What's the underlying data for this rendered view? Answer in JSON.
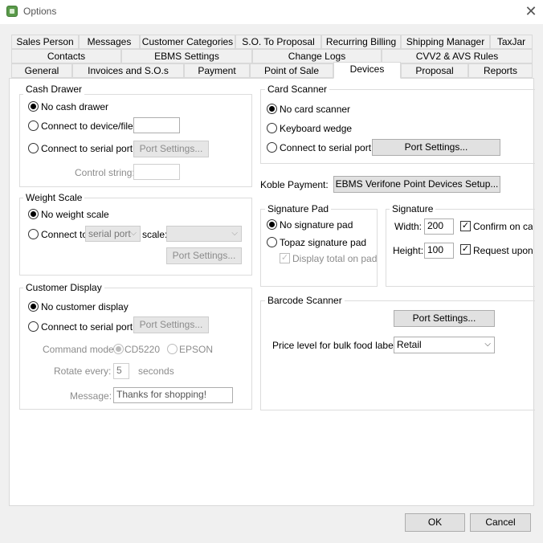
{
  "window": {
    "title": "Options"
  },
  "tabs": {
    "row1": [
      "Sales Person",
      "Messages",
      "Customer Categories",
      "S.O. To Proposal",
      "Recurring Billing",
      "Shipping Manager",
      "TaxJar"
    ],
    "row2": [
      "Contacts",
      "EBMS Settings",
      "Change Logs",
      "CVV2 & AVS Rules"
    ],
    "row3": [
      "General",
      "Invoices and S.O.s",
      "Payment",
      "Point of Sale",
      "Devices",
      "Proposal",
      "Reports"
    ],
    "active": "Devices"
  },
  "cash_drawer": {
    "title": "Cash Drawer",
    "opt_none": "No cash drawer",
    "opt_device": "Connect to device/file:",
    "opt_serial": "Connect to serial port:",
    "port_settings": "Port Settings...",
    "control_string": "Control string:"
  },
  "weight_scale": {
    "title": "Weight Scale",
    "opt_none": "No weight scale",
    "opt_connect": "Connect to",
    "port_type": "serial port",
    "scale_label": "scale:",
    "port_settings": "Port Settings..."
  },
  "customer_display": {
    "title": "Customer Display",
    "opt_none": "No customer display",
    "opt_serial": "Connect to serial port:",
    "port_settings": "Port Settings...",
    "command_mode": "Command mode:",
    "mode_cd": "CD5220",
    "mode_epson": "EPSON",
    "rotate_every": "Rotate every:",
    "rotate_value": "5",
    "seconds": "seconds",
    "message_label": "Message:",
    "message_value": "Thanks for shopping!"
  },
  "card_scanner": {
    "title": "Card Scanner",
    "opt_none": "No card scanner",
    "opt_wedge": "Keyboard wedge",
    "opt_serial": "Connect to serial port:",
    "port_settings": "Port Settings..."
  },
  "koble": {
    "label": "Koble Payment:",
    "button": "EBMS Verifone Point Devices Setup..."
  },
  "signature_pad": {
    "title": "Signature Pad",
    "opt_none": "No signature pad",
    "opt_topaz": "Topaz signature pad",
    "display_total": "Display total on pad"
  },
  "signature": {
    "title": "Signature",
    "width_label": "Width:",
    "width_value": "200",
    "height_label": "Height:",
    "height_value": "100",
    "confirm": "Confirm on capt",
    "request": "Request upon In"
  },
  "barcode": {
    "title": "Barcode Scanner",
    "port_settings": "Port Settings...",
    "price_label": "Price level for bulk food label:",
    "price_value": "Retail"
  },
  "buttons": {
    "ok": "OK",
    "cancel": "Cancel"
  },
  "icons": {
    "close": "✕",
    "check": "✓",
    "chevron": "⌵"
  }
}
